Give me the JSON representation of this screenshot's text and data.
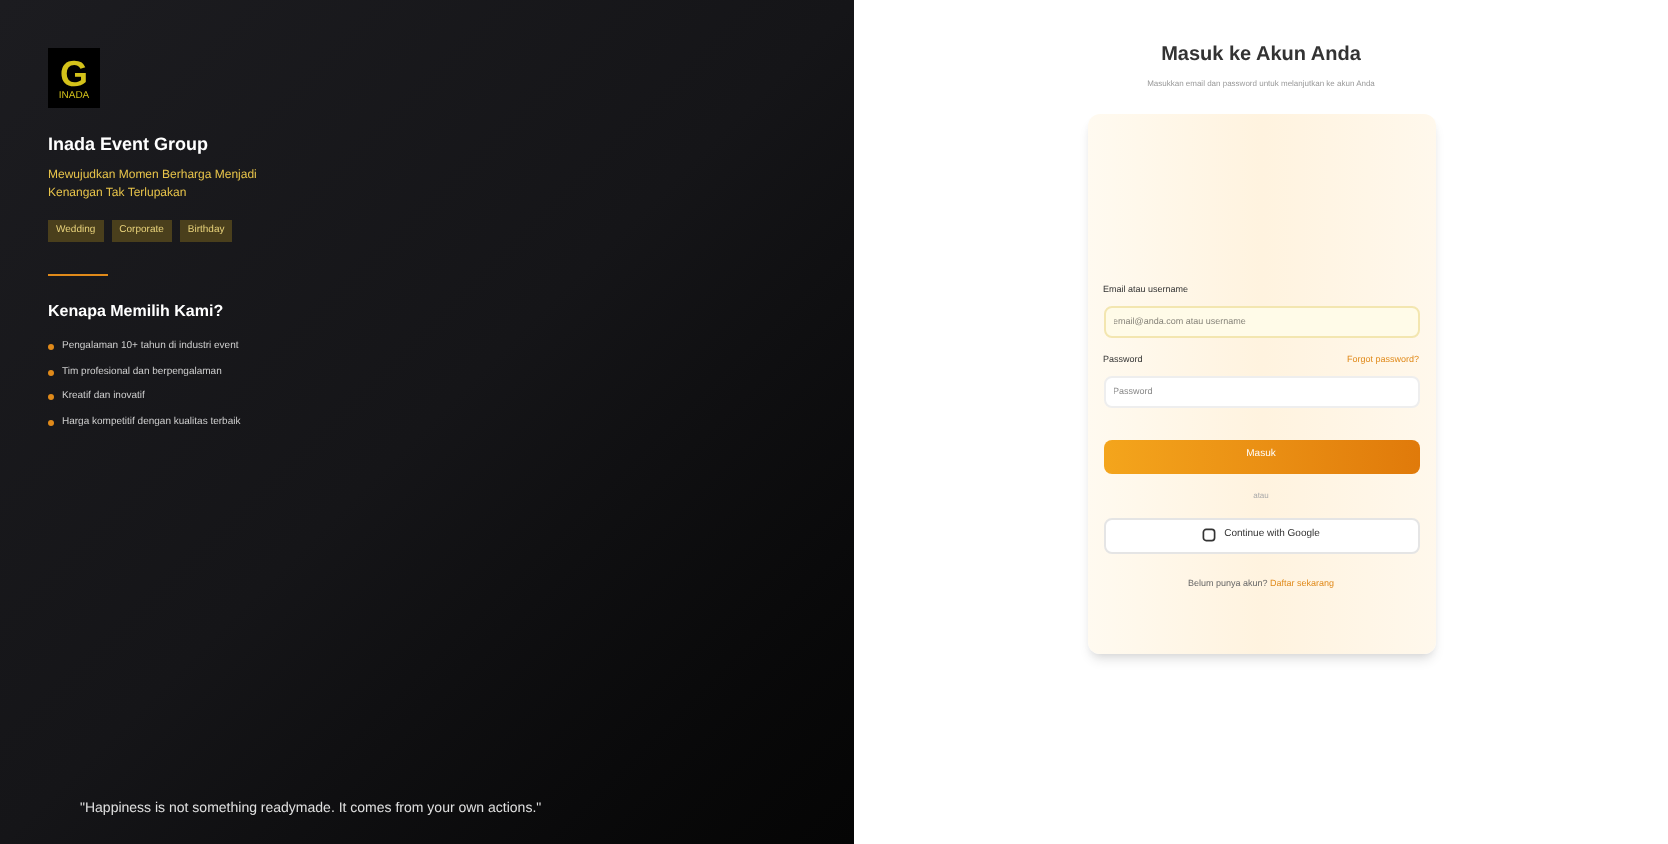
{
  "brand": {
    "logo_letter": "G",
    "logo_caption": "INADA",
    "name": "Inada Event Group",
    "tagline": "Mewujudkan Momen Berharga Menjadi Kenangan Tak Terlupakan",
    "tags": [
      "Wedding",
      "Corporate",
      "Birthday"
    ]
  },
  "why": {
    "title": "Kenapa Memilih Kami?",
    "points": [
      "Pengalaman 10+ tahun di industri event",
      "Tim profesional dan berpengalaman",
      "Kreatif dan inovatif",
      "Harga kompetitif dengan kualitas terbaik"
    ]
  },
  "quote": "\"Happiness is not something readymade. It comes from your own actions.\"",
  "login": {
    "title": "Masuk ke Akun Anda",
    "subtitle": "Masukkan email dan password untuk melanjutkan ke akun Anda",
    "email": {
      "label": "Email atau username",
      "placeholder": "email@anda.com atau username"
    },
    "password": {
      "label": "Password",
      "placeholder": "Password",
      "forgot": "Forgot password?"
    },
    "submit": "Masuk",
    "divider": "atau",
    "google": "Continue with Google",
    "signup_prompt": "Belum punya akun?",
    "signup_link": "Daftar sekarang"
  }
}
